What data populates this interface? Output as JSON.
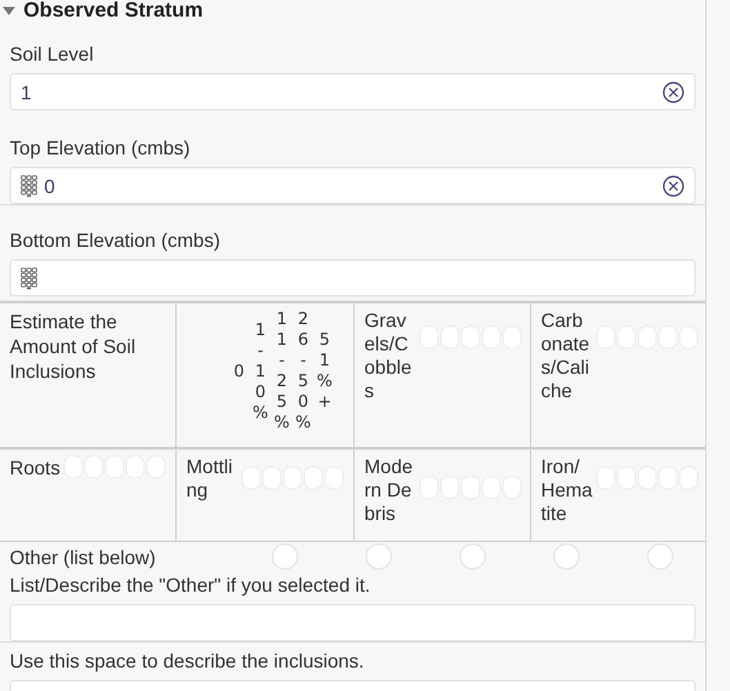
{
  "section": {
    "title": "Observed Stratum",
    "expanded": true
  },
  "fields_top": [
    {
      "label": "Soil Level",
      "kind": "text",
      "value": "1",
      "clear_button": true
    },
    {
      "label": "Top Elevation (cmbs)",
      "kind": "numeric",
      "value": "0",
      "clear_button": true
    },
    {
      "label": "Bottom Elevation (cmbs)",
      "kind": "numeric",
      "clear_button": false
    }
  ],
  "inclusions": {
    "question": "Estimate the Amount of Soil Inclusions",
    "columns": [
      "0",
      "1-10%",
      "11-25%",
      "26-50%",
      "51%+"
    ],
    "rows": [
      {
        "label": "Gravels/Cobbles",
        "options": [
          {
            "selected": false
          },
          {
            "selected": false
          },
          {
            "selected": false
          },
          {
            "selected": false
          },
          {
            "selected": false
          }
        ]
      },
      {
        "label": "Carbonates/Caliche",
        "options": [
          {
            "selected": false
          },
          {
            "selected": false
          },
          {
            "selected": false
          },
          {
            "selected": false
          },
          {
            "selected": false
          }
        ]
      },
      {
        "label": "Roots",
        "options": [
          {
            "selected": false
          },
          {
            "selected": false
          },
          {
            "selected": false
          },
          {
            "selected": false
          },
          {
            "selected": false
          }
        ]
      },
      {
        "label": "Mottling",
        "options": [
          {
            "selected": false
          },
          {
            "selected": false
          },
          {
            "selected": false
          },
          {
            "selected": false
          },
          {
            "selected": false
          }
        ]
      },
      {
        "label": "Modern Debris",
        "options": [
          {
            "selected": false
          },
          {
            "selected": false
          },
          {
            "selected": false
          },
          {
            "selected": false
          },
          {
            "selected": false
          }
        ]
      },
      {
        "label": "Iron/Hematite",
        "options": [
          {
            "selected": false
          },
          {
            "selected": false
          },
          {
            "selected": false
          },
          {
            "selected": false
          },
          {
            "selected": false
          }
        ]
      }
    ],
    "other": {
      "label": "Other (list below)",
      "options": [
        {
          "selected": false
        },
        {
          "selected": false
        },
        {
          "selected": false
        },
        {
          "selected": false
        },
        {
          "selected": false
        }
      ]
    }
  },
  "fields_bottom": [
    {
      "label": "List/Describe the \"Other\" if you selected it.",
      "clear_button": false
    },
    {
      "label": "Use this space to describe the inclusions.",
      "clear_button": false
    }
  ]
}
